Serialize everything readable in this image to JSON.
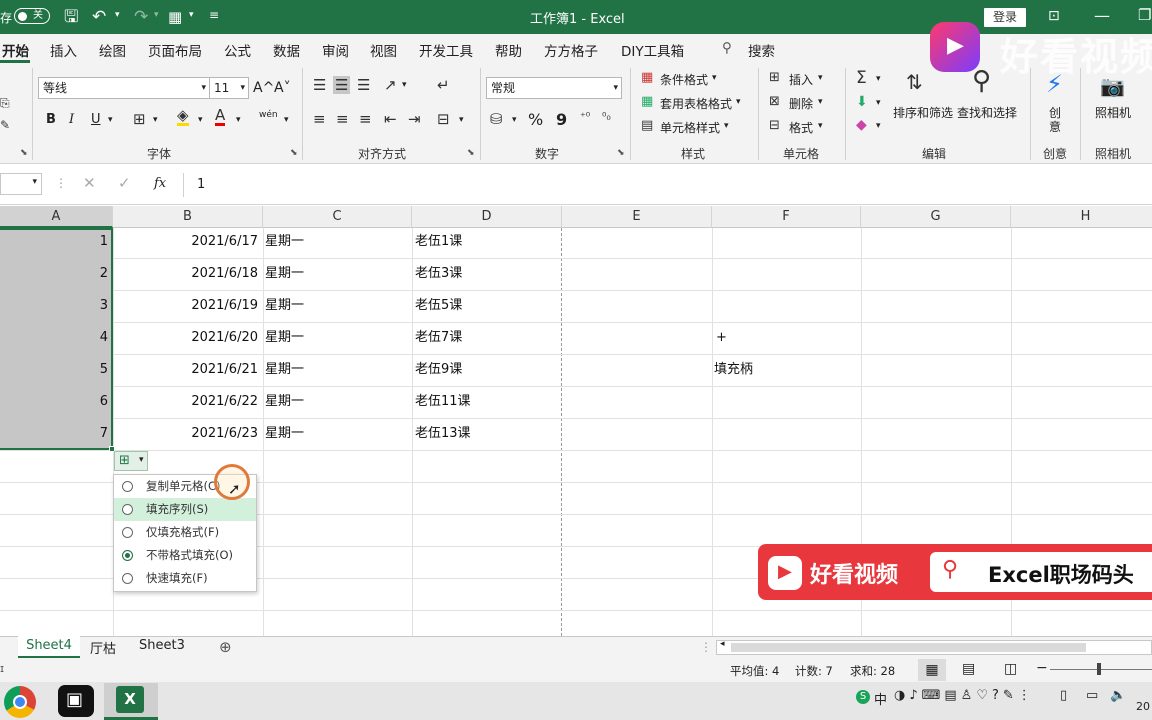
{
  "titlebar": {
    "autosave_fragment": "存",
    "autosave_state": "关",
    "title": "工作簿1 - Excel",
    "login": "登录"
  },
  "menu": [
    "开始",
    "插入",
    "绘图",
    "页面布局",
    "公式",
    "数据",
    "审阅",
    "视图",
    "开发工具",
    "帮助",
    "方方格子",
    "DIY工具箱",
    "搜索"
  ],
  "ribbon": {
    "font_name": "等线",
    "font_size": "11",
    "grow_font": "A^",
    "shrink_font": "A˅",
    "bold": "B",
    "italic": "I",
    "underline": "U",
    "number_format": "常规",
    "percent": "%",
    "comma": "9",
    "phonetic": "wén",
    "styles": {
      "conditional": "条件格式",
      "table": "套用表格格式",
      "cell": "单元格样式"
    },
    "cells": {
      "insert": "插入",
      "delete": "删除",
      "format": "格式"
    },
    "editing": {
      "sort": "排序和筛选",
      "find": "查找和选择"
    },
    "creative": "创意",
    "camera": "照相机",
    "groups": {
      "font": "字体",
      "align": "对齐方式",
      "number": "数字",
      "styles": "样式",
      "cells": "单元格",
      "editing": "编辑",
      "creative": "创意",
      "camera": "照相机"
    }
  },
  "formula": {
    "fx": "fx",
    "value": "1"
  },
  "columns": [
    "A",
    "B",
    "C",
    "D",
    "E",
    "F",
    "G",
    "H"
  ],
  "rows": [
    {
      "a": "1",
      "b": "2021/6/17",
      "c": "星期一",
      "d": "老伍1课",
      "f": ""
    },
    {
      "a": "2",
      "b": "2021/6/18",
      "c": "星期一",
      "d": "老伍3课",
      "f": ""
    },
    {
      "a": "3",
      "b": "2021/6/19",
      "c": "星期一",
      "d": "老伍5课",
      "f": ""
    },
    {
      "a": "4",
      "b": "2021/6/20",
      "c": "星期一",
      "d": "老伍7课",
      "f": "+"
    },
    {
      "a": "5",
      "b": "2021/6/21",
      "c": "星期一",
      "d": "老伍9课",
      "f": "填充柄"
    },
    {
      "a": "6",
      "b": "2021/6/22",
      "c": "星期一",
      "d": "老伍11课",
      "f": ""
    },
    {
      "a": "7",
      "b": "2021/6/23",
      "c": "星期一",
      "d": "老伍13课",
      "f": ""
    }
  ],
  "autofill_options": [
    {
      "label": "复制单元格(C)",
      "selected": false
    },
    {
      "label": "填充序列(S)",
      "selected": false
    },
    {
      "label": "仅填充格式(F)",
      "selected": false
    },
    {
      "label": "不带格式填充(O)",
      "selected": true
    },
    {
      "label": "快速填充(F)",
      "selected": false
    }
  ],
  "watermark": {
    "brand_top": "好看视频",
    "brand": "好看视频",
    "channel": "Excel职场码头"
  },
  "sheets": [
    "Sheet4",
    "厅枯",
    "Sheet3"
  ],
  "status": {
    "average": "平均值: 4",
    "count": "计数: 7",
    "sum": "求和: 28"
  },
  "taskbar": {
    "clock_fragment": "20",
    "ime": "中"
  },
  "colors": {
    "excel_green": "#217346",
    "selection": "#c6c6c6",
    "watermark_red": "#e8383d"
  }
}
